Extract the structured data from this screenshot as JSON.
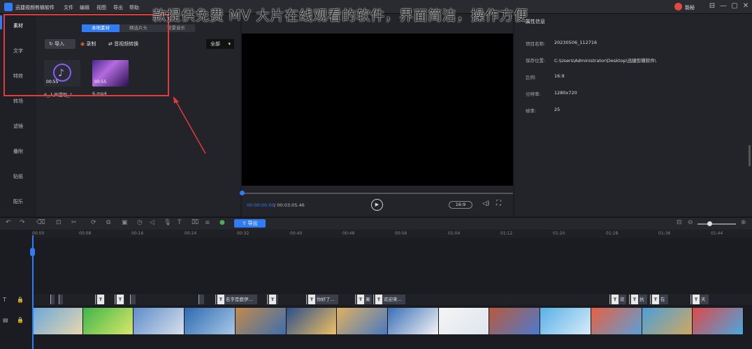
{
  "window": {
    "app_name": "迅捷视频剪辑软件",
    "menu": [
      "文件",
      "编辑",
      "视图",
      "导出",
      "帮助"
    ],
    "user": "能秘",
    "controls": [
      "⊟",
      "—",
      "▢",
      "✕"
    ]
  },
  "overlay_title": "款提供免费 MV 大片在线观看的软件，界面简洁，操作方便",
  "nav": [
    "素材",
    "文字",
    "特效",
    "转场",
    "滤镜",
    "叠附",
    "贴纸",
    "配乐"
  ],
  "media": {
    "tabs": [
      "本地素材",
      "精选片头",
      "背景音乐"
    ],
    "import_label": "导入",
    "record_label": "录制",
    "convert_label": "音视频转换",
    "filter_value": "全部",
    "items": [
      {
        "name": "6_人声提取_1...",
        "duration": "00:55"
      },
      {
        "name": "6.mp4",
        "duration": "00:55"
      }
    ]
  },
  "preview": {
    "current_time": "00:00:00.00",
    "total_time": "/ 00:03:05.46",
    "ratio": "16:9"
  },
  "props": {
    "tab": "属性信息",
    "rows": [
      {
        "label": "项目名称:",
        "value": "20230506_112716"
      },
      {
        "label": "保存位置:",
        "value": "C:\\Users\\Administrator\\Desktop\\迅捷剪辑软件\\"
      },
      {
        "label": "比例:",
        "value": "16:9"
      },
      {
        "label": "分辨率:",
        "value": "1280x720"
      },
      {
        "label": "帧率:",
        "value": "25"
      }
    ]
  },
  "timeline": {
    "export_label": "导出",
    "ticks": [
      "00:00",
      "00:08",
      "00:16",
      "00:24",
      "00:32",
      "00:40",
      "00:48",
      "00:56",
      "01:04",
      "01:12",
      "01:20",
      "01:28",
      "01:36",
      "01:44"
    ],
    "text_clips": [
      "名字是鹿伊...",
      "你好了...",
      "果",
      "欢迎来...",
      "欢",
      "抗",
      "在",
      "天"
    ]
  },
  "colors": {
    "accent": "#2f7cf6",
    "highlight_box": "#e23b3b"
  }
}
